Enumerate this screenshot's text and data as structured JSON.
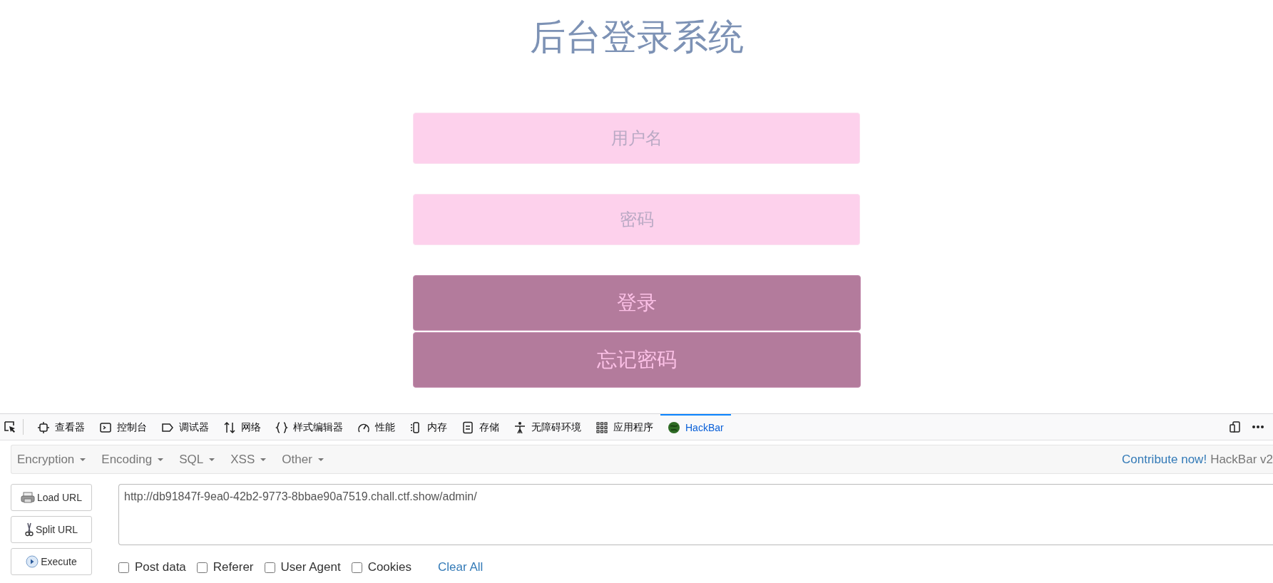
{
  "page": {
    "title": "后台登录系统",
    "fields": [
      {
        "placeholder": "用户名"
      },
      {
        "placeholder": "密码"
      }
    ],
    "buttons": [
      "登录",
      "忘记密码"
    ]
  },
  "devtools": {
    "tabs": [
      {
        "label": "查看器",
        "selected": false
      },
      {
        "label": "控制台",
        "selected": false
      },
      {
        "label": "调试器",
        "selected": false
      },
      {
        "label": "网络",
        "selected": false
      },
      {
        "label": "样式编辑器",
        "selected": false
      },
      {
        "label": "性能",
        "selected": false
      },
      {
        "label": "内存",
        "selected": false
      },
      {
        "label": "存储",
        "selected": false
      },
      {
        "label": "无障碍环境",
        "selected": false
      },
      {
        "label": "应用程序",
        "selected": false
      },
      {
        "label": "HackBar",
        "selected": true
      }
    ]
  },
  "hackbar": {
    "menus": [
      "Encryption",
      "Encoding",
      "SQL",
      "XSS",
      "Other"
    ],
    "contribute_link": "Contribute now!",
    "version": "HackBar v2",
    "actions": [
      {
        "label": "Load URL"
      },
      {
        "label": "Split URL"
      },
      {
        "label": "Execute"
      }
    ],
    "url": "http://db91847f-9ea0-42b2-9773-8bbae90a7519.chall.ctf.show/admin/",
    "options": [
      {
        "label": "Post data",
        "checked": false
      },
      {
        "label": "Referer",
        "checked": false
      },
      {
        "label": "User Agent",
        "checked": false
      },
      {
        "label": "Cookies",
        "checked": false
      }
    ],
    "clear_all": "Clear All"
  }
}
